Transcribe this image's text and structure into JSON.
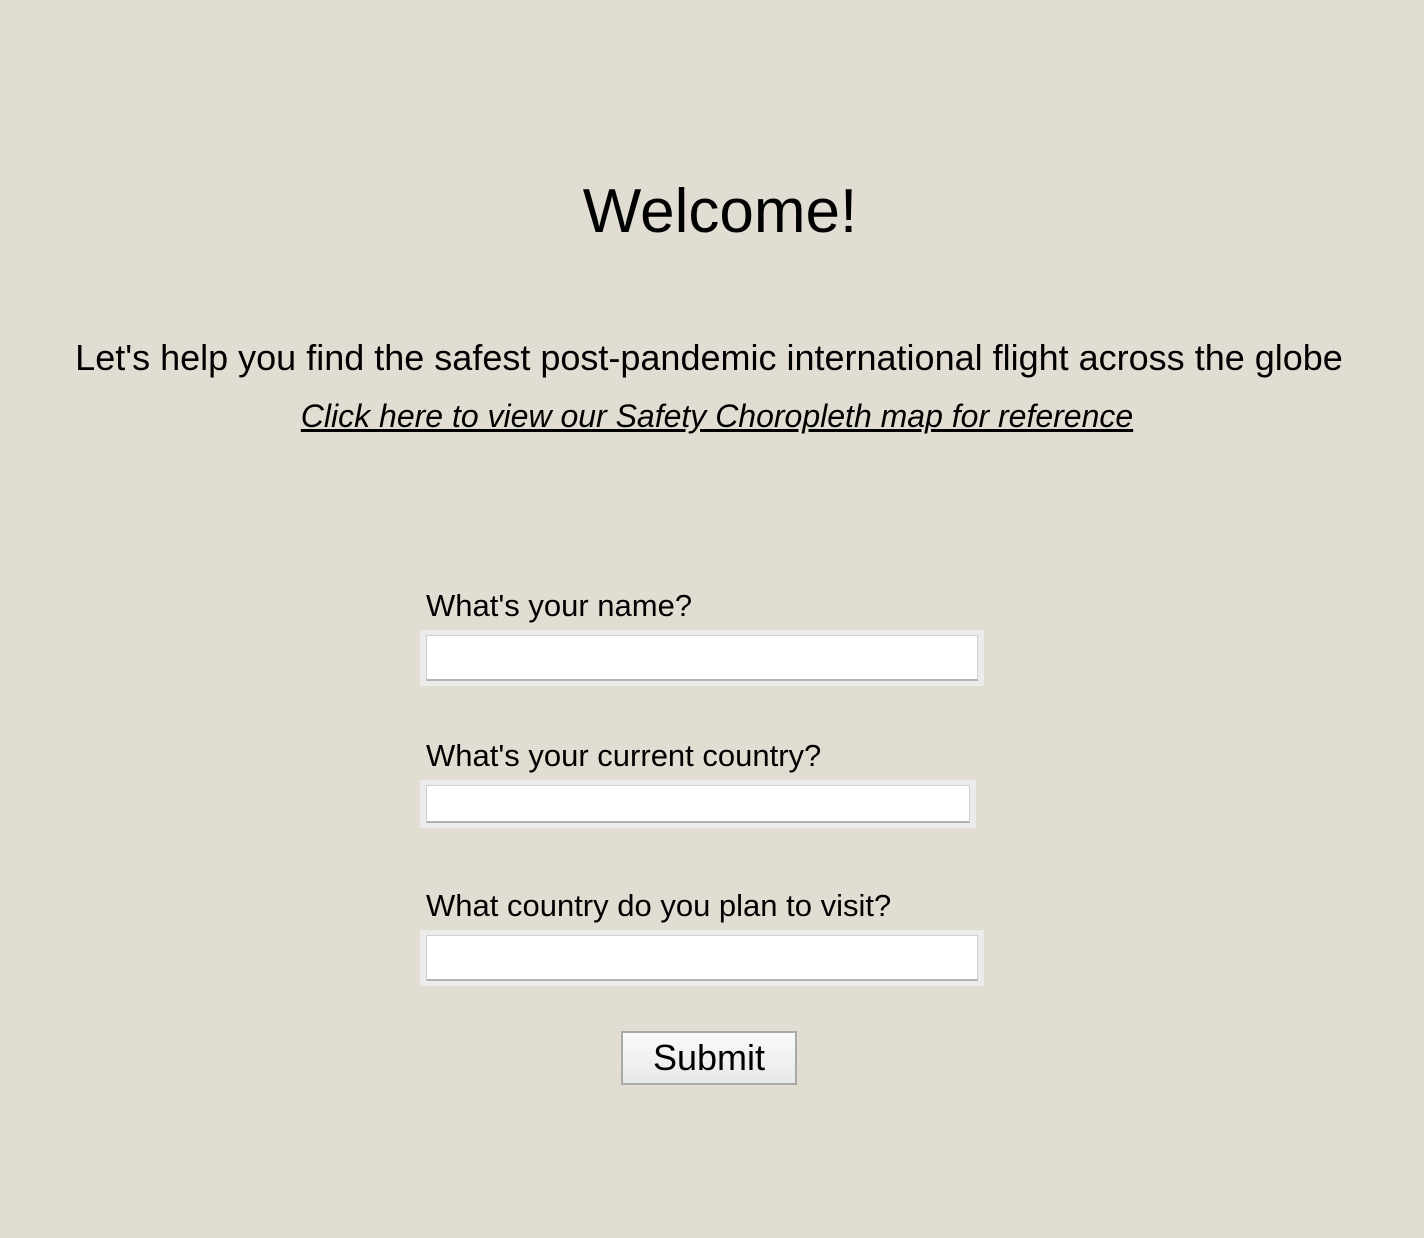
{
  "header": {
    "title": "Welcome!",
    "subtitle": "Let's help you find the safest post-pandemic international flight across the globe",
    "map_link_text": "Click here to view our Safety Choropleth map for reference"
  },
  "form": {
    "name_label": "What's your name?",
    "name_value": "",
    "current_country_label": "What's your current country?",
    "current_country_value": "",
    "destination_label": "What country do you plan to visit?",
    "destination_value": "",
    "submit_label": "Submit"
  },
  "colors": {
    "background": "#e1ddd2",
    "input_frame": "#ecebeb"
  }
}
